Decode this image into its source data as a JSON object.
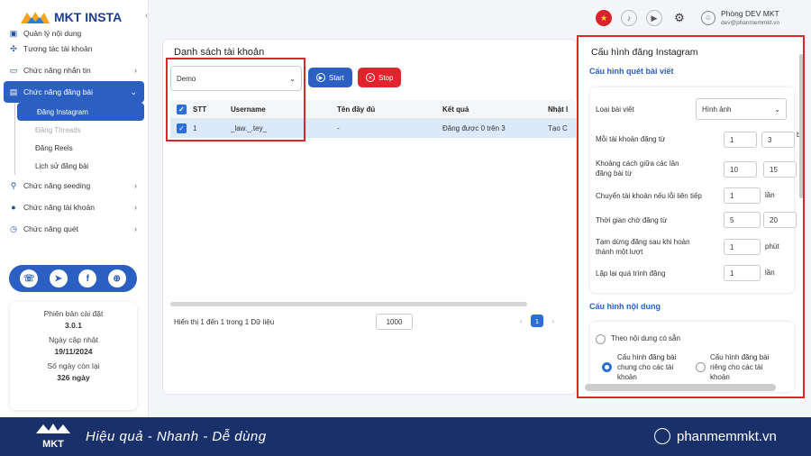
{
  "app": {
    "name": "MKT INSTA"
  },
  "sidebar": {
    "items": [
      {
        "label": "Quản lý nội dung"
      },
      {
        "label": "Tương tác tài khoản"
      },
      {
        "label": "Chức năng nhắn tin"
      },
      {
        "label": "Chức năng đăng bài"
      },
      {
        "label": "Chức năng seeding"
      },
      {
        "label": "Chức năng tài khoản"
      },
      {
        "label": "Chức năng quét"
      }
    ],
    "sub": [
      "Đăng Instagram",
      "Đăng Threads",
      "Đăng Reels",
      "Lịch sử đăng bài"
    ]
  },
  "info": {
    "version_label": "Phiên bản cài đặt",
    "version": "3.0.1",
    "update_label": "Ngày cập nhật",
    "update": "19/11/2024",
    "days_label": "Số ngày còn lại",
    "days": "326 ngày"
  },
  "user": {
    "name": "Phòng DEV MKT",
    "email": "dev@phanmemmkt.vn"
  },
  "accounts": {
    "title": "Danh sách tài khoản",
    "select_value": "Demo",
    "start": "Start",
    "stop": "Stop",
    "headers": [
      "STT",
      "Username",
      "Tên đầy đủ",
      "Kết quả",
      "Nhật l"
    ],
    "rows": [
      [
        "1",
        "_law._.tey_",
        "-",
        "Đăng được 0 trên 3",
        "Tạo C"
      ]
    ],
    "footer": "Hiển thị 1 đến 1 trong 1 Dữ liệu",
    "page_size": "1000",
    "page": "1"
  },
  "config": {
    "title": "Cấu hình đăng Instagram",
    "scan_section": "Cấu hình quét bài viết",
    "post_type_label": "Loại bài viết",
    "post_type": "Hình ảnh",
    "per_account_label": "Mỗi tài khoản đăng từ",
    "per_account_from": "1",
    "per_account_to": "3",
    "per_account_unit": "b",
    "interval_label": "Khoảng cách giữa các lần đăng bài từ",
    "interval_from": "10",
    "interval_to": "15",
    "switch_label": "Chuyển tài khoản nếu lỗi liên tiếp",
    "switch_value": "1",
    "switch_unit": "lần",
    "wait_label": "Thời gian chờ đăng từ",
    "wait_from": "5",
    "wait_to": "20",
    "pause_label": "Tạm dừng đăng sau khi hoàn thành một lượt",
    "pause_value": "1",
    "pause_unit": "phút",
    "repeat_label": "Lặp lại quá trình đăng",
    "repeat_value": "1",
    "repeat_unit": "lần",
    "content_section": "Cấu hình nội dung",
    "opt1": "Theo nội dung có sẵn",
    "opt2": "Cấu hình đăng bài chung cho các tài khoản",
    "opt3": "Cấu hình đăng bài riêng cho các tài khoản"
  },
  "banner": {
    "tagline": "Hiệu quả - Nhanh - Dễ dùng",
    "url": "phanmemmkt.vn",
    "logo_text": "MKT"
  },
  "colors": {
    "primary": "#2b5fc1",
    "danger": "#e0232c",
    "banner": "#19306a"
  }
}
